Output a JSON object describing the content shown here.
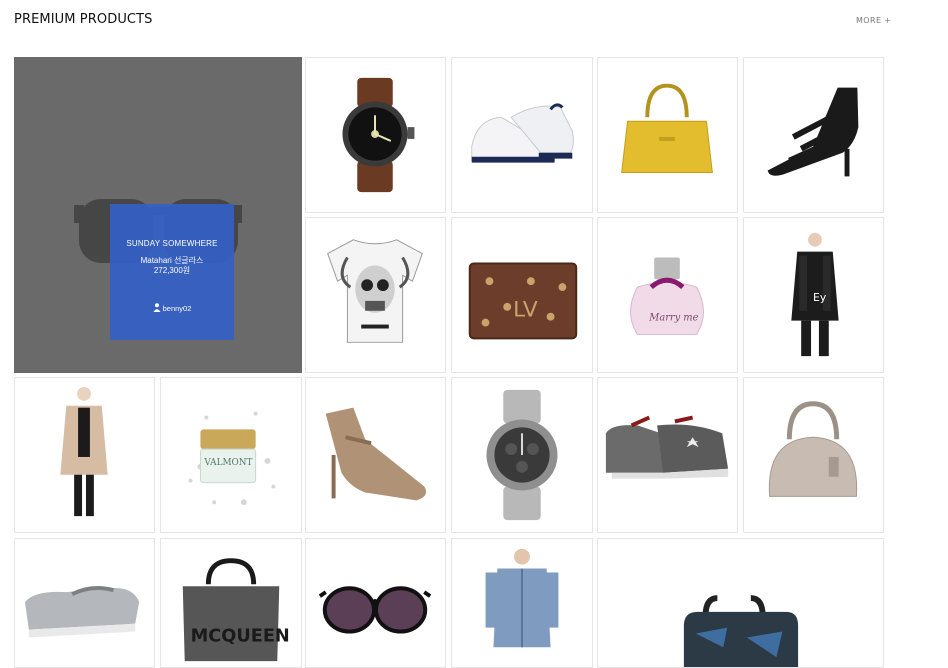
{
  "header": {
    "title": "PREMIUM PRODUCTS",
    "more_label": "MORE +"
  },
  "featured": {
    "title": "SUNDAY SOMEWHERE",
    "name": "Matahari 선글라스",
    "price": "272,300원",
    "user": "benny02",
    "icon": "sunglasses-icon"
  },
  "products": [
    {
      "icon": "watch-icon"
    },
    {
      "icon": "sneaker-icon"
    },
    {
      "icon": "handbag-icon"
    },
    {
      "icon": "sandal-icon"
    },
    {
      "icon": "tshirt-icon"
    },
    {
      "icon": "wallet-icon"
    },
    {
      "icon": "perfume-icon"
    },
    {
      "icon": "coat-icon"
    },
    {
      "icon": "cardigan-icon"
    },
    {
      "icon": "cream-jar-icon"
    },
    {
      "icon": "heel-icon"
    },
    {
      "icon": "chronograph-icon"
    },
    {
      "icon": "sneaker-icon"
    },
    {
      "icon": "handbag-icon"
    },
    {
      "icon": "loafer-icon"
    },
    {
      "icon": "tote-bag-icon"
    },
    {
      "icon": "sunglasses-icon"
    },
    {
      "icon": "shirt-icon"
    },
    {
      "icon": "backpack-icon"
    }
  ],
  "colors": {
    "overlay": "#3460c6",
    "featured_bg": "#6a6a6a"
  }
}
